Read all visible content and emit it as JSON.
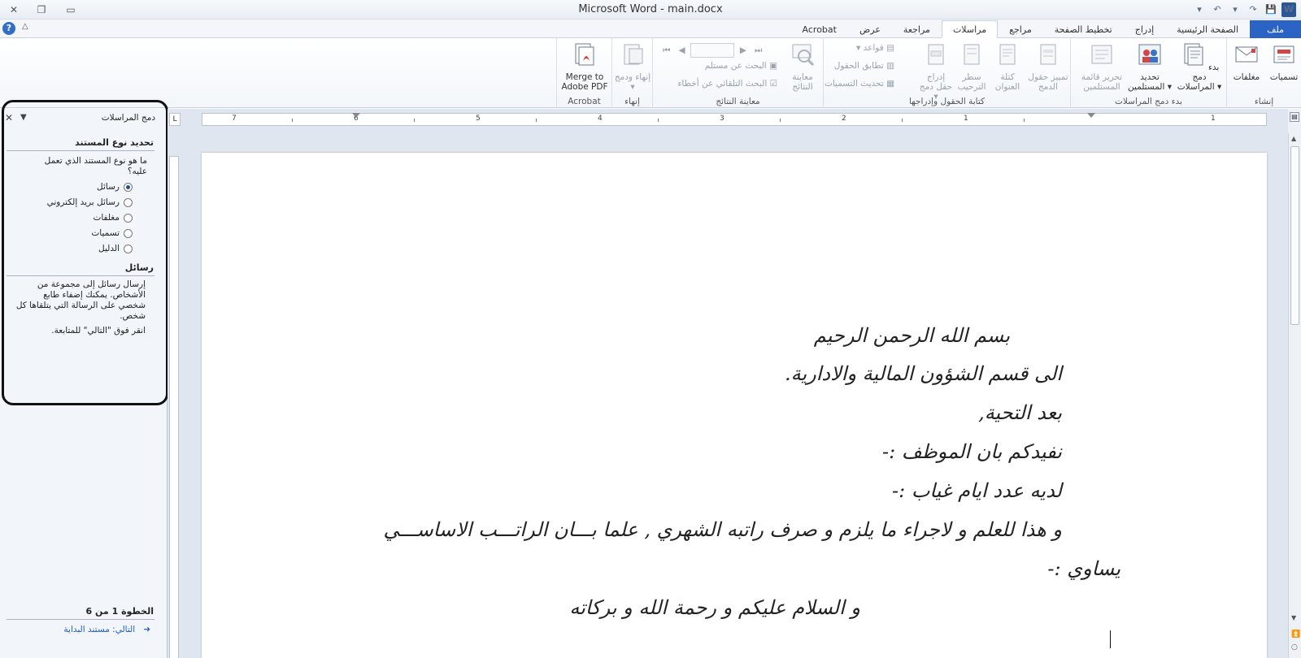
{
  "window": {
    "title": "Microsoft Word  -  main.docx",
    "close_glyph": "✕",
    "restore_glyph": "❐",
    "minimize_glyph": "▭"
  },
  "qat": {
    "word_logo": "W",
    "save": "💾",
    "redo": "↷",
    "undo_more": "▾",
    "undo": "↶",
    "customize": "▾"
  },
  "tabs": [
    {
      "label": "ملف",
      "state": "file"
    },
    {
      "label": "الصفحة الرئيسية",
      "state": ""
    },
    {
      "label": "إدراج",
      "state": ""
    },
    {
      "label": "تخطيط الصفحة",
      "state": ""
    },
    {
      "label": "مراجع",
      "state": ""
    },
    {
      "label": "مراسلات",
      "state": "active"
    },
    {
      "label": "مراجعة",
      "state": ""
    },
    {
      "label": "عرض",
      "state": ""
    },
    {
      "label": "Acrobat",
      "state": ""
    }
  ],
  "ribbon": {
    "create": {
      "label": "إنشاء",
      "envelopes": "مغلفات",
      "labels": "تسميات"
    },
    "start_merge": {
      "label": "بدء دمج المراسلات",
      "start": "بدء دمج المراسلات",
      "select": "تحديد المستلمين",
      "edit_list": "تحرير قائمة المستلمين"
    },
    "write_insert": {
      "label": "كتابة الحقول وإدراجها",
      "highlight": "تمييز حقول الدمج",
      "address_block": "كتلة العنوان",
      "greeting": "سطر الترحيب",
      "insert_field": "إدراج حقل دمج",
      "rules": "قواعد",
      "match_fields": "تطابق الحقول",
      "update_labels": "تحديث التسميات"
    },
    "preview": {
      "label": "معاينة النتائج",
      "preview_results": "معاينة النتائج",
      "find_recipient": "البحث عن مستلم",
      "auto_check": "البحث التلقائي عن أخطاء"
    },
    "finish": {
      "label": "إنهاء",
      "finish_merge": "إنهاء ودمج"
    },
    "acrobat": {
      "label": "Acrobat",
      "merge_pdf": "Merge to Adobe PDF"
    }
  },
  "ruler": {
    "numbers": [
      "7",
      "6",
      "5",
      "4",
      "3",
      "2",
      "1",
      "1"
    ]
  },
  "document": {
    "lines": [
      "بسم الله الرحمن الرحيم",
      "الى قسم الشؤون المالية والادارية.",
      "بعد التحية,",
      "نفيدكم بان الموظف :-",
      "لديه عدد ايام غياب :-",
      "و هذا للعلم و لاجراء ما يلزم و صرف راتبه الشهري , علما بـــان الراتـــب الاساســـي",
      "يساوي :-",
      "و السلام عليكم و رحمة الله و بركاته"
    ]
  },
  "taskpane": {
    "title": "دمج المراسلات",
    "section1": "تحديد نوع المستند",
    "question": "ما هو نوع المستند الذي تعمل عليه؟",
    "options": [
      {
        "label": "رسائل",
        "checked": true
      },
      {
        "label": "رسائل بريد إلكتروني",
        "checked": false
      },
      {
        "label": "مغلفات",
        "checked": false
      },
      {
        "label": "تسميات",
        "checked": false
      },
      {
        "label": "الدليل",
        "checked": false
      }
    ],
    "section2": "رسائل",
    "description": "إرسال رسائل إلى مجموعة من الأشخاص. يمكنك إضفاء طابع شخصي على الرسالة التي يتلقاها كل شخص.",
    "instruction": "انقر فوق \"التالي\" للمتابعة.",
    "step": "الخطوة 1 من 6",
    "next_label": "التالي",
    "next_target": "مستند البداية"
  },
  "colors": {
    "file_tab": "#2b63c4",
    "accent": "#2b5797"
  }
}
